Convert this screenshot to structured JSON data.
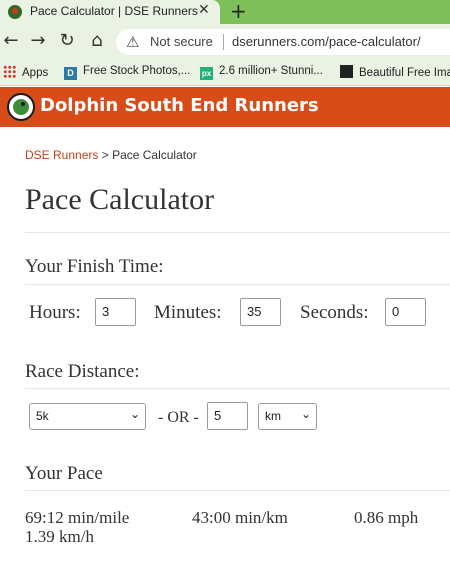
{
  "browser": {
    "tab_title": "Pace Calculator | DSE Runners",
    "tab_close": "✕",
    "new_tab": "+",
    "not_secure": "Not secure",
    "url": "dserunners.com/pace-calculator/",
    "bookmarks": [
      {
        "label": "Apps",
        "icon": "apps-grid-icon"
      },
      {
        "label": "Free Stock Photos,...",
        "icon": "d-bookmark-icon"
      },
      {
        "label": "2.6 million+ Stunni...",
        "icon": "px-bookmark-icon"
      },
      {
        "label": "Beautiful Free Ima",
        "icon": "bookmark-icon"
      }
    ]
  },
  "site": {
    "name": "Dolphin South End Runners",
    "header_color": "#d84c1a"
  },
  "breadcrumb": {
    "home": "DSE Runners",
    "separator": " > ",
    "current": "Pace Calculator"
  },
  "page_title": "Pace Calculator",
  "finish_time": {
    "heading": "Your Finish Time:",
    "hours_label": "Hours:",
    "hours_value": "3",
    "minutes_label": "Minutes:",
    "minutes_value": "35",
    "seconds_label": "Seconds:",
    "seconds_value": "0"
  },
  "race_distance": {
    "heading": "Race Distance:",
    "preset_selected": "5k",
    "or_label": "- OR -",
    "custom_value": "5",
    "unit_selected": "km"
  },
  "pace": {
    "heading": "Your Pace",
    "min_per_mile": "69:12 min/mile",
    "min_per_km": "43:00 min/km",
    "mph": "0.86 mph",
    "kmh": "1.39 km/h"
  }
}
